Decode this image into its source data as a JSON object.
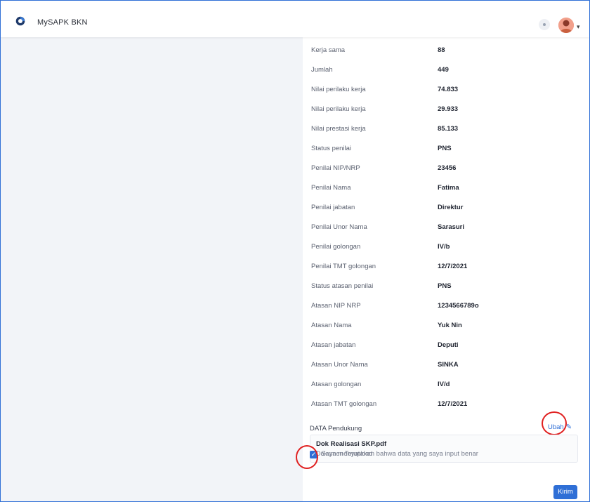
{
  "app": {
    "title": "MySAPK BKN"
  },
  "rows": [
    {
      "label": "Kerja sama",
      "value": "88"
    },
    {
      "label": "Jumlah",
      "value": "449"
    },
    {
      "label": "Nilai perilaku kerja",
      "value": "74.833"
    },
    {
      "label": "Nilai perilaku kerja",
      "value": "29.933"
    },
    {
      "label": "Nilai prestasi kerja",
      "value": "85.133"
    },
    {
      "label": "Status penilai",
      "value": "PNS"
    },
    {
      "label": "Penilai NIP/NRP",
      "value": "23456"
    },
    {
      "label": "Penilai Nama",
      "value": "Fatima"
    },
    {
      "label": "Penilai jabatan",
      "value": "Direktur"
    },
    {
      "label": "Penilai Unor Nama",
      "value": "Sarasuri"
    },
    {
      "label": "Penilai golongan",
      "value": "IV/b"
    },
    {
      "label": "Penilai TMT golongan",
      "value": "12/7/2021"
    },
    {
      "label": "Status atasan penilai",
      "value": "PNS"
    },
    {
      "label": "Atasan NIP NRP",
      "value": "1234566789o"
    },
    {
      "label": "Atasan Nama",
      "value": "Yuk Nin"
    },
    {
      "label": "Atasan jabatan",
      "value": "Deputi"
    },
    {
      "label": "Atasan Unor Nama",
      "value": "SINKA"
    },
    {
      "label": "Atasan golongan",
      "value": "IV/d"
    },
    {
      "label": "Atasan TMT golongan",
      "value": "12/7/2021"
    }
  ],
  "supporting": {
    "title": "DATA Pendukung",
    "edit_label": "Ubah",
    "document": {
      "name": "Dok Realisasi SKP.pdf",
      "status": "Dokumen Terupload"
    }
  },
  "declaration": {
    "checked": true,
    "label": "Saya menyatakan bahwa data yang saya input benar"
  },
  "actions": {
    "submit_label": "Kirim"
  },
  "colors": {
    "accent": "#2f6fd6",
    "annotation": "#e02020"
  },
  "icons": {
    "logo": "app-logo-icon",
    "notification": "bell-icon",
    "edit": "pencil-icon",
    "check": "checkmark-icon",
    "user_menu": "chevron-down-icon"
  }
}
